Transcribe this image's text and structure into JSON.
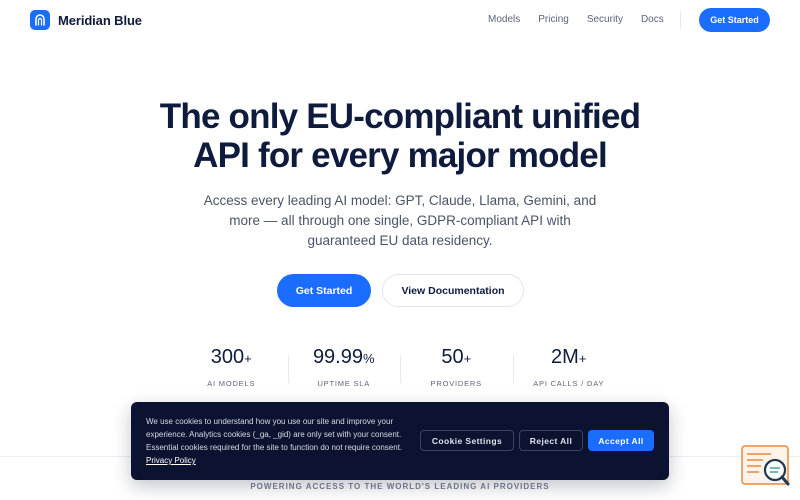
{
  "brand": {
    "name": "Meridian Blue",
    "color": "#1a6dff"
  },
  "nav": {
    "items": [
      "Models",
      "Pricing",
      "Security",
      "Docs"
    ],
    "cta": "Get Started"
  },
  "hero": {
    "title_line1": "The only EU-compliant unified",
    "title_line2": "API for every major model",
    "subtitle": "Access every leading AI model: GPT, Claude, Llama, Gemini, and more — all through one single, GDPR-compliant API with guaranteed EU data residency.",
    "primary_cta": "Get Started",
    "secondary_cta": "View Documentation"
  },
  "stats": [
    {
      "value": "300",
      "unit": "+",
      "label": "AI MODELS"
    },
    {
      "value": "99.99",
      "unit": "%",
      "label": "UPTIME SLA"
    },
    {
      "value": "50",
      "unit": "+",
      "label": "PROVIDERS"
    },
    {
      "value": "2M",
      "unit": "+",
      "label": "API CALLS / DAY"
    }
  ],
  "strip": {
    "powering": "POWERING ACCESS TO THE WORLD'S LEADING AI PROVIDERS"
  },
  "cookie": {
    "text": "We use cookies to understand how you use our site and improve your experience. Analytics cookies (_ga, _gid) are only set with your consent. Essential cookies required for the site to function do not require consent.",
    "policy_link": "Privacy Policy",
    "settings_label": "Cookie Settings",
    "reject_label": "Reject All",
    "accept_label": "Accept All"
  },
  "widget": {
    "icon": "search-chat-icon"
  },
  "colors": {
    "accent": "#1a6dff",
    "dark_navy": "#0f1b3d",
    "banner_bg": "#0c1330",
    "widget_orange": "#e8893a"
  }
}
